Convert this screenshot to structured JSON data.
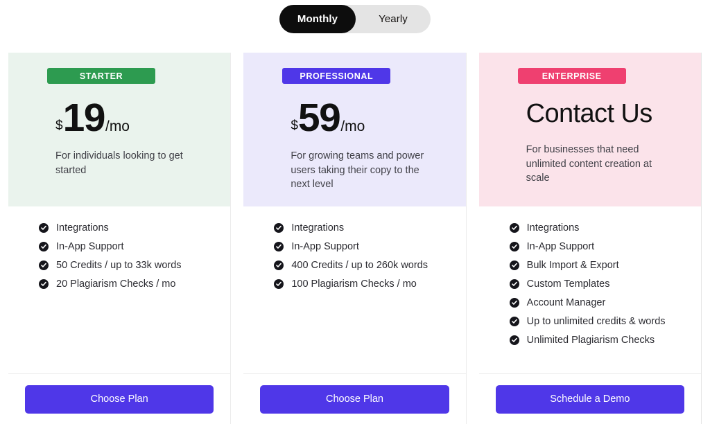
{
  "billing_toggle": {
    "options": [
      {
        "label": "Monthly",
        "active": true
      },
      {
        "label": "Yearly",
        "active": false
      }
    ]
  },
  "accent_colors": {
    "starter": "#2d9b50",
    "professional": "#4f37e8",
    "enterprise": "#ef4070",
    "cta": "#4f37e8",
    "toggle_active": "#0d0d0d",
    "toggle_track": "#e4e4e4"
  },
  "plans": [
    {
      "badge": "STARTER",
      "currency": "$",
      "amount": "19",
      "period": "/mo",
      "description": "For individuals looking to get started",
      "features": [
        "Integrations",
        "In-App Support",
        "50 Credits / up to 33k words",
        "20 Plagiarism Checks / mo"
      ],
      "cta": "Choose Plan"
    },
    {
      "badge": "PROFESSIONAL",
      "currency": "$",
      "amount": "59",
      "period": "/mo",
      "description": "For growing teams and power users taking their copy to the next level",
      "features": [
        "Integrations",
        "In-App Support",
        "400 Credits / up to 260k words",
        "100 Plagiarism Checks / mo"
      ],
      "cta": "Choose Plan"
    },
    {
      "badge": "ENTERPRISE",
      "headline": "Contact Us",
      "description": "For businesses that need unlimited content creation at scale",
      "features": [
        "Integrations",
        "In-App Support",
        "Bulk Import & Export",
        "Custom Templates",
        "Account Manager",
        "Up to unlimited credits & words",
        "Unlimited Plagiarism Checks"
      ],
      "cta": "Schedule a Demo"
    }
  ],
  "icons": {
    "check": "check-circle-icon"
  }
}
